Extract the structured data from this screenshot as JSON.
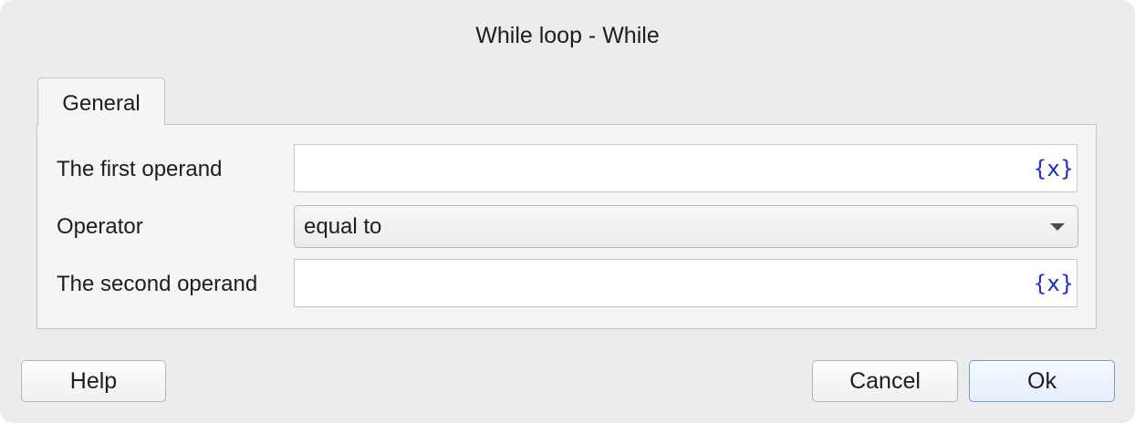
{
  "dialog": {
    "title": "While loop - While"
  },
  "tabs": [
    {
      "label": "General",
      "active": true
    }
  ],
  "form": {
    "first_operand": {
      "label": "The first operand",
      "value": "",
      "variable_icon": "{x}"
    },
    "operator": {
      "label": "Operator",
      "selected": "equal to"
    },
    "second_operand": {
      "label": "The second operand",
      "value": "",
      "variable_icon": "{x}"
    }
  },
  "buttons": {
    "help": "Help",
    "cancel": "Cancel",
    "ok": "Ok"
  },
  "colors": {
    "variable_icon": "#1f30c8",
    "default_button_border": "#6f9fd8"
  }
}
